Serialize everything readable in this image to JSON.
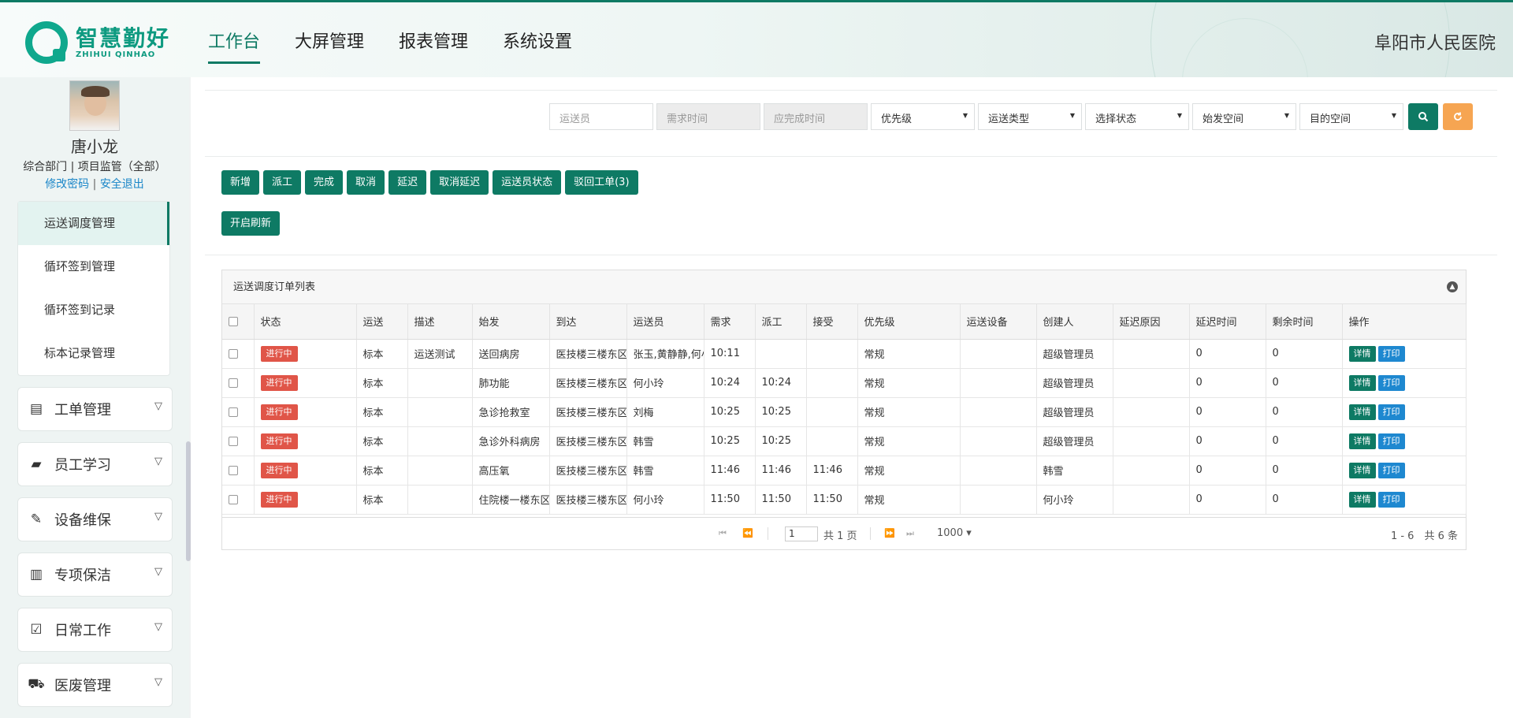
{
  "logo": {
    "cn": "智慧勤好",
    "en": "ZHIHUI QINHAO"
  },
  "topnav": [
    {
      "label": "工作台"
    },
    {
      "label": "大屏管理"
    },
    {
      "label": "报表管理"
    },
    {
      "label": "系统设置"
    }
  ],
  "hospital": "阜阳市人民医院",
  "user": {
    "name": "唐小龙",
    "dept": "综合部门 | 项目监管（全部）",
    "change_password": "修改密码",
    "separator": " | ",
    "logout": "安全退出"
  },
  "subnav": [
    {
      "label": "运送调度管理"
    },
    {
      "label": "循环签到管理"
    },
    {
      "label": "循环签到记录"
    },
    {
      "label": "标本记录管理"
    }
  ],
  "menus": [
    {
      "label": "工单管理",
      "icon": "list-icon",
      "glyph": "▤"
    },
    {
      "label": "员工学习",
      "icon": "book-icon",
      "glyph": "▰"
    },
    {
      "label": "设备维保",
      "icon": "wrench-icon",
      "glyph": "✎"
    },
    {
      "label": "专项保洁",
      "icon": "trash-icon",
      "glyph": "▥"
    },
    {
      "label": "日常工作",
      "icon": "check-square-icon",
      "glyph": "☑"
    },
    {
      "label": "医废管理",
      "icon": "ambulance-icon",
      "glyph": "⛟"
    }
  ],
  "filters": {
    "transporter_placeholder": "运送员",
    "demand_time_placeholder": "需求时间",
    "due_time_placeholder": "应完成时间",
    "priority": "优先级",
    "transport_type": "运送类型",
    "status": "选择状态",
    "origin": "始发空间",
    "destination": "目的空间"
  },
  "actions": {
    "add": "新增",
    "dispatch": "派工",
    "complete": "完成",
    "cancel": "取消",
    "delay": "延迟",
    "cancel_delay": "取消延迟",
    "staff_status": "运送员状态",
    "rejected": "驳回工单(3)",
    "auto_refresh": "开启刷新"
  },
  "grid": {
    "caption": "运送调度订单列表",
    "columns": [
      "状态",
      "运送",
      "描述",
      "始发",
      "到达",
      "运送员",
      "需求",
      "派工",
      "接受",
      "优先级",
      "运送设备",
      "创建人",
      "延迟原因",
      "延迟时间",
      "剩余时间",
      "操作"
    ],
    "rows": [
      {
        "status": "进行中",
        "type": "标本",
        "desc": "运送测试",
        "from": "送回病房",
        "to": "医技楼三楼东区",
        "staff": "张玉,黄静静,何小玲",
        "demand": "10:11",
        "dispatch": "",
        "accept": "",
        "priority": "常规",
        "device": "",
        "creator": "超级管理员",
        "delay_reason": "",
        "delay_time": "0",
        "remain": "0"
      },
      {
        "status": "进行中",
        "type": "标本",
        "desc": "",
        "from": "肺功能",
        "to": "医技楼三楼东区",
        "staff": "何小玲",
        "demand": "10:24",
        "dispatch": "10:24",
        "accept": "",
        "priority": "常规",
        "device": "",
        "creator": "超级管理员",
        "delay_reason": "",
        "delay_time": "0",
        "remain": "0"
      },
      {
        "status": "进行中",
        "type": "标本",
        "desc": "",
        "from": "急诊抢救室",
        "to": "医技楼三楼东区",
        "staff": "刘梅",
        "demand": "10:25",
        "dispatch": "10:25",
        "accept": "",
        "priority": "常规",
        "device": "",
        "creator": "超级管理员",
        "delay_reason": "",
        "delay_time": "0",
        "remain": "0"
      },
      {
        "status": "进行中",
        "type": "标本",
        "desc": "",
        "from": "急诊外科病房",
        "to": "医技楼三楼东区",
        "staff": "韩雪",
        "demand": "10:25",
        "dispatch": "10:25",
        "accept": "",
        "priority": "常规",
        "device": "",
        "creator": "超级管理员",
        "delay_reason": "",
        "delay_time": "0",
        "remain": "0"
      },
      {
        "status": "进行中",
        "type": "标本",
        "desc": "",
        "from": "高压氧",
        "to": "医技楼三楼东区",
        "staff": "韩雪",
        "demand": "11:46",
        "dispatch": "11:46",
        "accept": "11:46",
        "priority": "常规",
        "device": "",
        "creator": "韩雪",
        "delay_reason": "",
        "delay_time": "0",
        "remain": "0"
      },
      {
        "status": "进行中",
        "type": "标本",
        "desc": "",
        "from": "住院楼一楼东区",
        "to": "医技楼三楼东区",
        "staff": "何小玲",
        "demand": "11:50",
        "dispatch": "11:50",
        "accept": "11:50",
        "priority": "常规",
        "device": "",
        "creator": "何小玲",
        "delay_reason": "",
        "delay_time": "0",
        "remain": "0"
      }
    ],
    "op_detail": "详情",
    "op_print": "打印"
  },
  "pager": {
    "page": "1",
    "total_pages": "共 1 页",
    "page_size": "1000 ▾",
    "range": "1 - 6　共 6 条"
  },
  "colors": {
    "primary": "#0e7a64",
    "danger": "#e05548",
    "info": "#1e88d0",
    "warning": "#f6a552"
  }
}
